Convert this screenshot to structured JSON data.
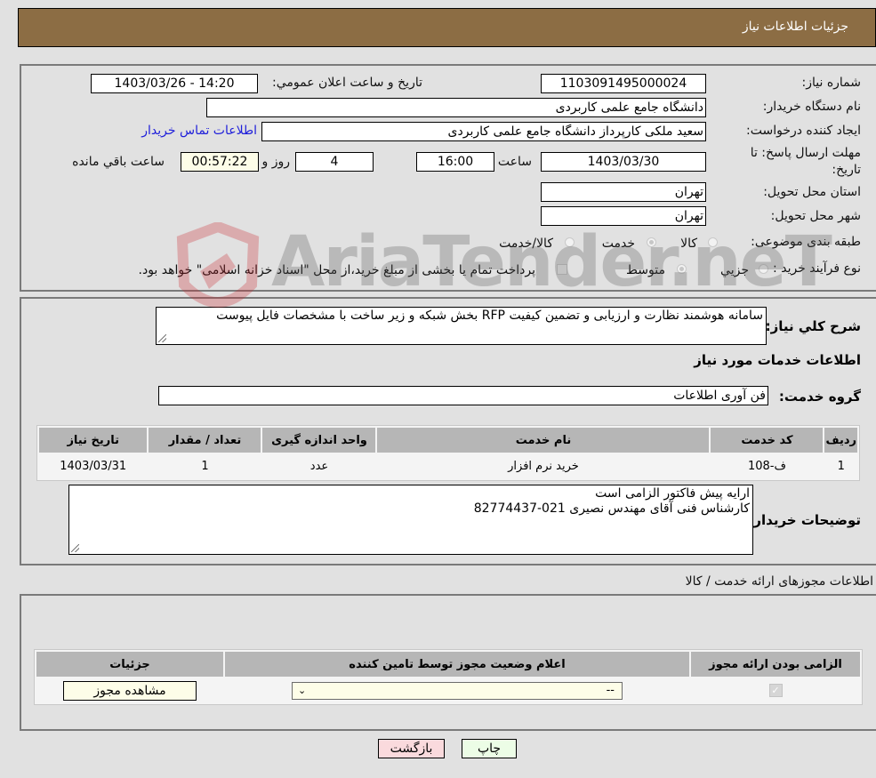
{
  "header": {
    "title": "جزئیات اطلاعات نیاز"
  },
  "details": {
    "need_number_label": "شماره نیاز:",
    "need_number": "1103091495000024",
    "announce_label": "تاریخ و ساعت اعلان عمومي:",
    "announce_value": "1403/03/26 - 14:20",
    "buyer_org_label": "نام دستگاه خریدار:",
    "buyer_org": "دانشگاه جامع علمی کاربردی",
    "creator_label": "ایجاد کننده درخواست:",
    "creator": "سعید ملکی کارپرداز دانشگاه جامع علمی کاربردی",
    "contact_link": "اطلاعات تماس خریدار",
    "deadline_label_1": "مهلت ارسال پاسخ: تا",
    "deadline_label_2": "تاریخ:",
    "deadline_date": "1403/03/30",
    "time_label": "ساعت",
    "deadline_time": "16:00",
    "days": "4",
    "days_label": "روز و",
    "remaining": "00:57:22",
    "remaining_label": "ساعت باقي مانده",
    "province_label": "استان محل تحویل:",
    "province": "تهران",
    "city_label": "شهر محل تحویل:",
    "city": "تهران",
    "category_label": "طبقه بندی موضوعی:",
    "category_options": [
      {
        "label": "کالا",
        "checked": false
      },
      {
        "label": "خدمت",
        "checked": true
      },
      {
        "label": "کالا/خدمت",
        "checked": false
      }
    ],
    "process_label": "نوع فرآیند خرید :",
    "process_options": [
      {
        "label": "جزیي",
        "checked": false
      },
      {
        "label": "متوسط",
        "checked": true
      }
    ],
    "treasury_checkbox_label": "پرداخت تمام یا بخشی از مبلغ خرید،از محل \"اسناد خزانه اسلامی\" خواهد بود.",
    "treasury_checked": false
  },
  "description": {
    "label": "شرح کلي نیاز:",
    "value": "سامانه هوشمند نظارت و ارزیابی و تضمین کیفیت RFP بخش شبکه و زیر ساخت با مشخصات فایل پیوست",
    "services_heading": "اطلاعات خدمات مورد نیاز",
    "service_group_label": "گروه خدمت:",
    "service_group": "فن آوری اطلاعات"
  },
  "services_table": {
    "headers": [
      "ردیف",
      "کد خدمت",
      "نام خدمت",
      "واحد اندازه گیری",
      "تعداد / مقدار",
      "تاریخ نیاز"
    ],
    "rows": [
      [
        "1",
        "ف-108",
        "خرید نرم افزار",
        "عدد",
        "1",
        "1403/03/31"
      ]
    ]
  },
  "buyer_notes": {
    "label": "توضیحات خریدار:",
    "line1": "ارایه پیش فاکتور الزامی است",
    "line2": "کارشناس فنی آقای مهندس نصیری 021-82774437"
  },
  "permits": {
    "title": "اطلاعات مجوزهای ارائه خدمت / کالا",
    "headers": [
      "الزامی بودن ارائه مجوز",
      "اعلام وضعیت مجوز توسط تامین کننده",
      "جزئیات"
    ],
    "row": {
      "required": true,
      "status_selected": "--",
      "details_button": "مشاهده مجوز"
    }
  },
  "footer": {
    "print_button": "چاپ",
    "back_button": "بازگشت"
  },
  "watermark": {
    "text": "AriaTender.neT"
  }
}
